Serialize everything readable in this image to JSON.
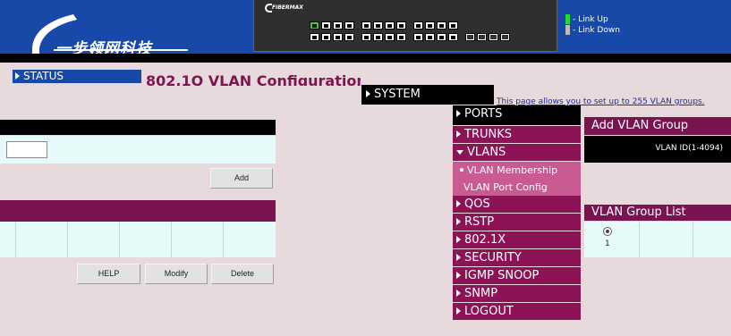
{
  "header": {
    "brand": "一步领网科技",
    "switch_logo_text": "FIBERMAX",
    "legend": {
      "link_up": "- Link Up",
      "link_down": "- Link Down"
    },
    "colors": {
      "header_blue": "#1848a8",
      "menu_magenta": "#8c1356",
      "link_up": "#1fdc3a",
      "link_down": "#bdbdbd"
    }
  },
  "status_menu": {
    "label": "STATUS"
  },
  "page": {
    "title": "802.1Q VLAN Configuration",
    "description": "This page allows you to set up to 255 VLAN groups."
  },
  "form": {
    "vlan_id_value": "",
    "add_label": "Add",
    "help_label": "HELP",
    "modify_label": "Modify",
    "delete_label": "Delete"
  },
  "nav": {
    "system_label": "SYSTEM",
    "ports_label": "PORTS",
    "items": [
      {
        "label": "TRUNKS"
      },
      {
        "label": "VLANS"
      },
      {
        "label": "VLAN Membership"
      },
      {
        "label": "VLAN Port Config"
      },
      {
        "label": "QOS"
      },
      {
        "label": "RSTP"
      },
      {
        "label": "802.1X"
      },
      {
        "label": "SECURITY"
      },
      {
        "label": "IGMP SNOOP"
      },
      {
        "label": "SNMP"
      },
      {
        "label": "LOGOUT"
      }
    ]
  },
  "add_group": {
    "header": "Add VLAN Group",
    "id_label": "VLAN ID(1-4094)"
  },
  "group_list": {
    "header": "VLAN Group List",
    "rows": [
      {
        "index": "1",
        "selected": true
      }
    ]
  }
}
